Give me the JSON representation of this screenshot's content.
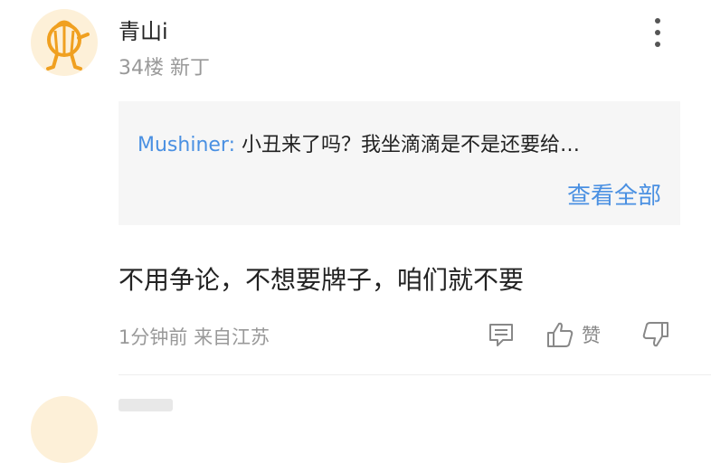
{
  "comment": {
    "username": "青山i",
    "floor": "34楼",
    "badge": "新丁",
    "quote": {
      "author": "Mushiner:",
      "text": "小丑来了吗？我坐滴滴是不是还要给…",
      "view_all": "查看全部"
    },
    "text": "不用争论，不想要牌子，咱们就不要",
    "time": "1分钟前",
    "location": "来自江苏",
    "like_label": "赞"
  },
  "colors": {
    "link": "#4a90e2",
    "avatar_bg": "#fdf0d8",
    "avatar_figure": "#f0a020"
  },
  "icons": [
    "more-icon",
    "reply-icon",
    "thumbs-up-icon",
    "thumbs-down-icon"
  ]
}
